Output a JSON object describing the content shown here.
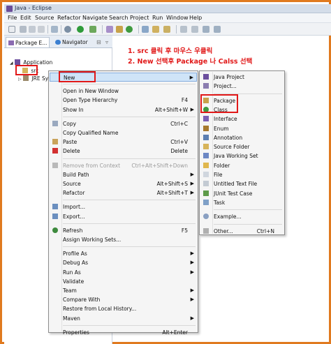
{
  "window": {
    "title": "Java - Eclipse"
  },
  "menubar": [
    "File",
    "Edit",
    "Source",
    "Refactor",
    "Navigate",
    "Search",
    "Project",
    "Run",
    "Window",
    "Help"
  ],
  "view": {
    "tabs": [
      {
        "label": "Package E..."
      },
      {
        "label": "Navigator"
      }
    ],
    "tree": [
      {
        "label": "Application",
        "icon": "project-icon"
      },
      {
        "label": "src",
        "icon": "package-folder-icon"
      },
      {
        "label": "JRE Sy",
        "icon": "library-icon"
      }
    ]
  },
  "annotations": {
    "line1": "1. src 클릭 후 마우스 우클릭",
    "line2": "2. New 선택후 Package 나 Calss 선택"
  },
  "context_menu": {
    "items": [
      {
        "label": "New",
        "shortcut": "",
        "submenu": true,
        "highlighted": true
      },
      {
        "sep": true
      },
      {
        "label": "Open in New Window",
        "shortcut": ""
      },
      {
        "label": "Open Type Hierarchy",
        "shortcut": "F4"
      },
      {
        "label": "Show In",
        "shortcut": "Alt+Shift+W",
        "submenu": true
      },
      {
        "sep": true
      },
      {
        "label": "Copy",
        "shortcut": "Ctrl+C",
        "icon": "copy-icon"
      },
      {
        "label": "Copy Qualified Name",
        "shortcut": ""
      },
      {
        "label": "Paste",
        "shortcut": "Ctrl+V",
        "icon": "paste-icon"
      },
      {
        "label": "Delete",
        "shortcut": "Delete",
        "icon": "delete-icon"
      },
      {
        "sep": true
      },
      {
        "label": "Remove from Context",
        "shortcut": "Ctrl+Alt+Shift+Down",
        "disabled": true,
        "icon": "remove-context-icon"
      },
      {
        "label": "Build Path",
        "shortcut": "",
        "submenu": true
      },
      {
        "label": "Source",
        "shortcut": "Alt+Shift+S",
        "submenu": true
      },
      {
        "label": "Refactor",
        "shortcut": "Alt+Shift+T",
        "submenu": true
      },
      {
        "sep": true
      },
      {
        "label": "Import...",
        "shortcut": "",
        "icon": "import-icon"
      },
      {
        "label": "Export...",
        "shortcut": "",
        "icon": "export-icon"
      },
      {
        "sep": true
      },
      {
        "label": "Refresh",
        "shortcut": "F5",
        "icon": "refresh-icon"
      },
      {
        "label": "Assign Working Sets...",
        "shortcut": ""
      },
      {
        "sep": true
      },
      {
        "label": "Profile As",
        "shortcut": "",
        "submenu": true
      },
      {
        "label": "Debug As",
        "shortcut": "",
        "submenu": true
      },
      {
        "label": "Run As",
        "shortcut": "",
        "submenu": true
      },
      {
        "label": "Validate",
        "shortcut": ""
      },
      {
        "label": "Team",
        "shortcut": "",
        "submenu": true
      },
      {
        "label": "Compare With",
        "shortcut": "",
        "submenu": true
      },
      {
        "label": "Restore from Local History...",
        "shortcut": ""
      },
      {
        "label": "Maven",
        "shortcut": "",
        "submenu": true
      },
      {
        "sep": true
      },
      {
        "label": "Properties",
        "shortcut": "Alt+Enter"
      }
    ]
  },
  "new_submenu": {
    "items": [
      {
        "label": "Java Project",
        "icon": "java-project-icon"
      },
      {
        "label": "Project...",
        "icon": "project-icon"
      },
      {
        "sep": true
      },
      {
        "label": "Package",
        "icon": "package-icon",
        "boxed": true
      },
      {
        "label": "Class",
        "icon": "class-icon",
        "boxed": true
      },
      {
        "label": "Interface",
        "icon": "interface-icon"
      },
      {
        "label": "Enum",
        "icon": "enum-icon"
      },
      {
        "label": "Annotation",
        "icon": "annotation-icon"
      },
      {
        "label": "Source Folder",
        "icon": "source-folder-icon"
      },
      {
        "label": "Java Working Set",
        "icon": "working-set-icon"
      },
      {
        "label": "Folder",
        "icon": "folder-icon"
      },
      {
        "label": "File",
        "icon": "file-icon"
      },
      {
        "label": "Untitled Text File",
        "icon": "text-file-icon"
      },
      {
        "label": "JUnit Test Case",
        "icon": "junit-icon"
      },
      {
        "label": "Task",
        "icon": "task-icon"
      },
      {
        "sep": true
      },
      {
        "label": "Example...",
        "icon": "example-icon"
      },
      {
        "sep": true
      },
      {
        "label": "Other...",
        "icon": "other-icon",
        "shortcut": "Ctrl+N"
      }
    ]
  },
  "colors": {
    "annotation": "#e11818",
    "frame": "#e07a1f",
    "highlight": "#cfe4f8"
  }
}
